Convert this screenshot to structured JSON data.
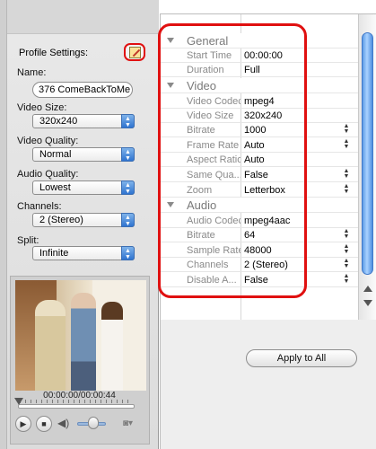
{
  "profile": {
    "title": "Profile Settings:",
    "name_label": "Name:",
    "name_value": "376 ComeBackToMe",
    "video_size_label": "Video Size:",
    "video_size_value": "320x240",
    "video_quality_label": "Video Quality:",
    "video_quality_value": "Normal",
    "audio_quality_label": "Audio Quality:",
    "audio_quality_value": "Lowest",
    "channels_label": "Channels:",
    "channels_value": "2 (Stereo)",
    "split_label": "Split:",
    "split_value": "Infinite",
    "edit_icon": "pencil-edit-icon"
  },
  "player": {
    "timecode": "00:00:00/00:00:44"
  },
  "properties": {
    "groups": [
      {
        "name": "General",
        "rows": [
          {
            "label": "Start Time",
            "value": "00:00:00",
            "stepper": false
          },
          {
            "label": "Duration",
            "value": "Full",
            "stepper": false
          }
        ]
      },
      {
        "name": "Video",
        "rows": [
          {
            "label": "Video Codec",
            "value": "mpeg4",
            "stepper": false
          },
          {
            "label": "Video Size",
            "value": "320x240",
            "stepper": false
          },
          {
            "label": "Bitrate",
            "value": "1000",
            "stepper": true
          },
          {
            "label": "Frame Rate",
            "value": "Auto",
            "stepper": true
          },
          {
            "label": "Aspect Ratio",
            "value": "Auto",
            "stepper": false
          },
          {
            "label": "Same Qua...",
            "value": "False",
            "stepper": true
          },
          {
            "label": "Zoom",
            "value": "Letterbox",
            "stepper": true
          }
        ]
      },
      {
        "name": "Audio",
        "rows": [
          {
            "label": "Audio Codec",
            "value": "mpeg4aac",
            "stepper": false
          },
          {
            "label": "Bitrate",
            "value": "64",
            "stepper": true
          },
          {
            "label": "Sample Rate",
            "value": "48000",
            "stepper": true
          },
          {
            "label": "Channels",
            "value": "2 (Stereo)",
            "stepper": true
          },
          {
            "label": "Disable A...",
            "value": "False",
            "stepper": true
          }
        ]
      }
    ]
  },
  "actions": {
    "apply_all": "Apply to All"
  },
  "colors": {
    "highlight": "#e01010",
    "scroll_thumb": "#5c9be6"
  }
}
